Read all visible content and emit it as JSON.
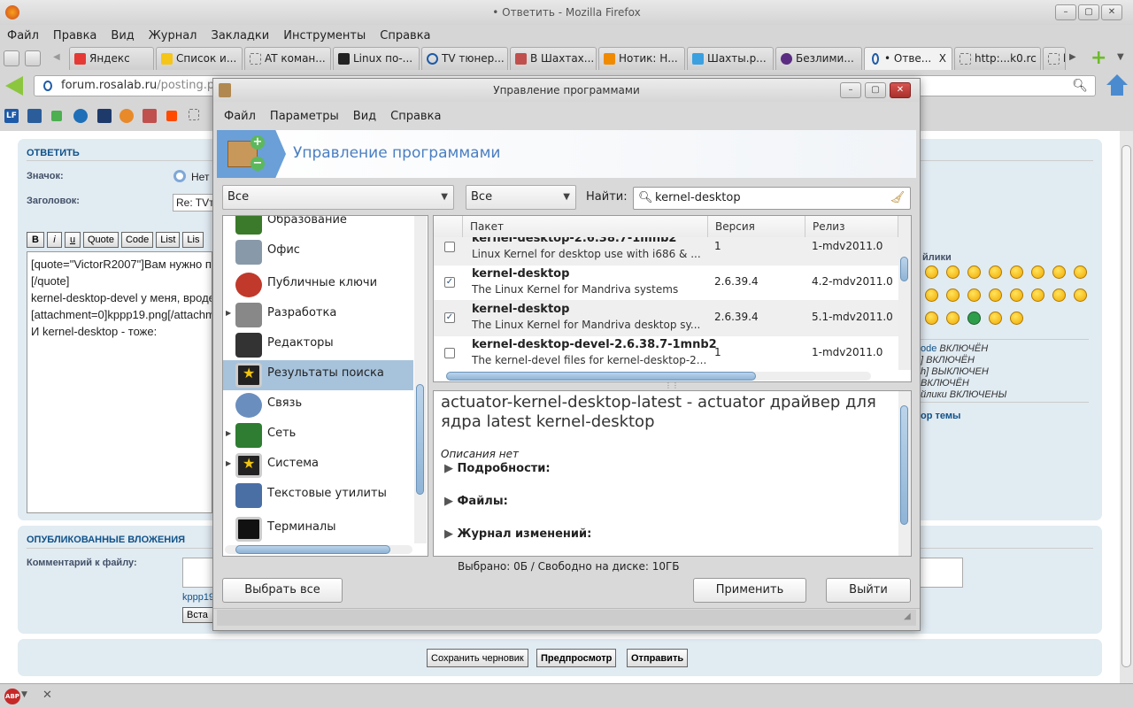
{
  "window": {
    "title": "• Ответить - Mozilla Firefox",
    "min": "–",
    "max": "▢",
    "close": "✕"
  },
  "menu": [
    "Файл",
    "Правка",
    "Вид",
    "Журнал",
    "Закладки",
    "Инструменты",
    "Справка"
  ],
  "tabs": [
    {
      "label": "Яндекс",
      "icon_color": "#e53935"
    },
    {
      "label": "Список и...",
      "icon_color": "#f5c518"
    },
    {
      "label": "AT коман...",
      "icon_color": ""
    },
    {
      "label": "Linux по-...",
      "icon_color": "#222222"
    },
    {
      "label": "TV тюнер...",
      "icon_color": "#1e5aa8"
    },
    {
      "label": "В Шахтах...",
      "icon_color": "#c0504d"
    },
    {
      "label": "Нотик: Н...",
      "icon_color": "#f08a00"
    },
    {
      "label": "Шахты.р...",
      "icon_color": "#3aa0e0"
    },
    {
      "label": "Безлими...",
      "icon_color": "#5a2d82"
    },
    {
      "label": "• Отве...",
      "icon_color": "#1e5aa8",
      "active": true,
      "close": "X"
    },
    {
      "label": "http:...k0.rc",
      "icon_color": ""
    },
    {
      "label": "h",
      "icon_color": ""
    }
  ],
  "nav": {
    "url_domain": "forum.rosalab.ru",
    "url_path": "/posting.ph",
    "new_tab": "+"
  },
  "forum": {
    "reply_title": "ОТВЕТИТЬ",
    "icon_label": "Значок:",
    "icon_value": "Нет",
    "subject_label": "Заголовок:",
    "subject_value": "Re: TVт",
    "format_buttons": [
      "B",
      "i",
      "u",
      "Quote",
      "Code",
      "List",
      "Lis"
    ],
    "message_lines": [
      "[quote=\"VictorR2007\"]Вам нужно п",
      "[/quote]",
      "kernel-desktop-devel у меня, вроде",
      "[attachment=0]kppp19.png[/attachm",
      "И kernel-desktop - тоже:"
    ],
    "smilies_title": "йлики",
    "options": [
      {
        "a": "ode",
        "b": " ВКЛЮЧЁН"
      },
      {
        "a": "",
        "b": "] ВКЛЮЧЁН"
      },
      {
        "a": "",
        "b": "h] ВЫКЛЮЧЕН"
      },
      {
        "a": "",
        "b": " ВКЛЮЧЁН"
      },
      {
        "a": "",
        "b": "йлики ВКЛЮЧЕНЫ"
      }
    ],
    "topic_review": "ор темы",
    "attachments_title": "ОПУБЛИКОВАННЫЕ ВЛОЖЕНИЯ",
    "comment_label": "Комментарий к файлу:",
    "attachment_name": "kppp19",
    "insert_button": "Вста",
    "save_draft": "Сохранить черновик",
    "preview": "Предпросмотр",
    "submit": "Отправить"
  },
  "dialog": {
    "title": "Управление программами",
    "menu": [
      "Файл",
      "Параметры",
      "Вид",
      "Справка"
    ],
    "banner": "Управление программами",
    "filter1": "Все",
    "filter2": "Все",
    "find_label": "Найти:",
    "search_value": "kernel-desktop",
    "categories": [
      {
        "label": "Образование",
        "expandable": false,
        "color": "#3a7a2a"
      },
      {
        "label": "Офис",
        "expandable": false,
        "color": "#8899aa"
      },
      {
        "label": "Публичные ключи",
        "expandable": false,
        "color": "#c0392b"
      },
      {
        "label": "Разработка",
        "expandable": true,
        "color": "#888888"
      },
      {
        "label": "Редакторы",
        "expandable": false,
        "color": "#333333"
      },
      {
        "label": "Результаты поиска",
        "expandable": false,
        "selected": true,
        "color": "#f1c40f"
      },
      {
        "label": "Связь",
        "expandable": false,
        "color": "#6a8fbf"
      },
      {
        "label": "Сеть",
        "expandable": true,
        "color": "#2e7d32"
      },
      {
        "label": "Система",
        "expandable": true,
        "color": "#f1c40f"
      },
      {
        "label": "Текстовые утилиты",
        "expandable": false,
        "color": "#4a6fa5"
      },
      {
        "label": "Терминалы",
        "expandable": false,
        "color": "#111111"
      }
    ],
    "columns": [
      "Пакет",
      "Версия",
      "Релиз"
    ],
    "packages": [
      {
        "name": "kernel-desktop-2.6.38.7-1mnb2",
        "desc": "Linux Kernel for desktop use with i686 & ...",
        "version": "1",
        "release": "1-mdv2011.0",
        "checked": false
      },
      {
        "name": "kernel-desktop",
        "desc": "The Linux Kernel for Mandriva systems",
        "version": "2.6.39.4",
        "release": "4.2-mdv2011.0",
        "checked": true
      },
      {
        "name": "kernel-desktop",
        "desc": "The Linux Kernel for Mandriva desktop sy...",
        "version": "2.6.39.4",
        "release": "5.1-mdv2011.0",
        "checked": true
      },
      {
        "name": "kernel-desktop-devel-2.6.38.7-1mnb2",
        "desc": "The kernel-devel files for kernel-desktop-2...",
        "version": "1",
        "release": "1-mdv2011.0",
        "checked": false
      }
    ],
    "detail_title": "actuator-kernel-desktop-latest - actuator драйвер для ядра latest kernel-desktop",
    "no_description": "Описания нет",
    "sections": [
      "Подробности:",
      "Файлы:",
      "Журнал изменений:"
    ],
    "status": "Выбрано: 0Б / Свободно на диске: 10ГБ",
    "select_all": "Выбрать все",
    "apply": "Применить",
    "quit": "Выйти"
  },
  "statusbar": {
    "abp": "ABP",
    "close": "✕"
  }
}
